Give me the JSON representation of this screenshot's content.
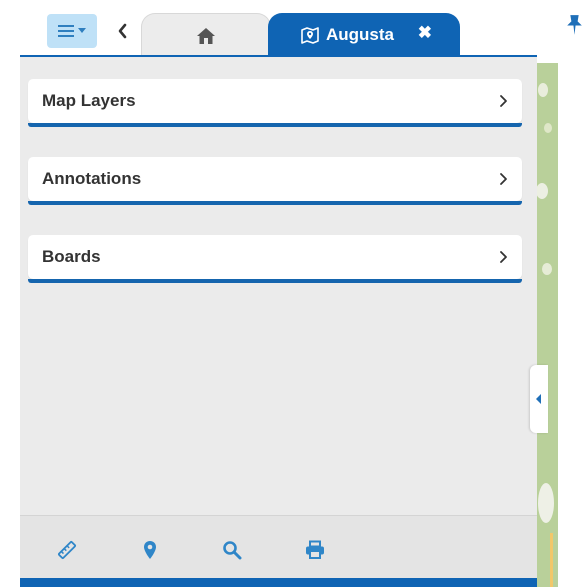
{
  "tabs": {
    "menu_icon": "hamburger-dropdown-icon",
    "back_icon": "chevron-left-icon",
    "home_icon": "home-icon",
    "active": {
      "label": "Augusta",
      "icon": "map-marker-icon",
      "close_icon": "close-icon"
    }
  },
  "panel": {
    "items": [
      {
        "label": "Map Layers"
      },
      {
        "label": "Annotations"
      },
      {
        "label": "Boards"
      }
    ]
  },
  "toolbar": {
    "tools": [
      {
        "icon": "ruler-icon"
      },
      {
        "icon": "location-pin-icon"
      },
      {
        "icon": "search-icon"
      },
      {
        "icon": "print-icon"
      }
    ]
  },
  "colors": {
    "accent": "#0f64b4",
    "menu_button_bg": "#bfe1f7",
    "panel_bg": "#ebebeb",
    "icon_blue": "#2f86c8"
  }
}
